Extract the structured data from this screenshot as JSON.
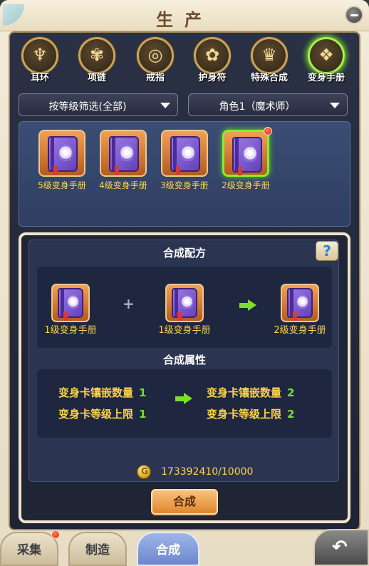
{
  "window": {
    "title": "生产"
  },
  "categories": [
    {
      "label": "耳环",
      "icon": "earring-icon",
      "glyph": "♆"
    },
    {
      "label": "项链",
      "icon": "necklace-icon",
      "glyph": "✾"
    },
    {
      "label": "戒指",
      "icon": "ring-icon",
      "glyph": "◎"
    },
    {
      "label": "护身符",
      "icon": "amulet-icon",
      "glyph": "✿"
    },
    {
      "label": "特殊合成",
      "icon": "special-synthesis-icon",
      "glyph": "♛"
    },
    {
      "label": "变身手册",
      "icon": "transform-manual-icon",
      "glyph": "❖",
      "active": true
    }
  ],
  "filters": {
    "level_filter": "按等级筛选(全部)",
    "character": "角色1（魔术师）"
  },
  "items": [
    {
      "label": "5级变身手册",
      "icon": "purple-book-icon"
    },
    {
      "label": "4级变身手册",
      "icon": "purple-book-icon"
    },
    {
      "label": "3级变身手册",
      "icon": "purple-book-icon"
    },
    {
      "label": "2级变身手册",
      "icon": "purple-book-icon",
      "selected": true,
      "notification": true
    }
  ],
  "recipe": {
    "title": "合成配方",
    "help_label": "?",
    "inputs": [
      "1级变身手册",
      "1级变身手册"
    ],
    "plus": "+",
    "output": "2级变身手册"
  },
  "attributes": {
    "title": "合成属性",
    "before": [
      {
        "name": "变身卡镶嵌数量",
        "value": "1"
      },
      {
        "name": "变身卡等级上限",
        "value": "1"
      }
    ],
    "after": [
      {
        "name": "变身卡镶嵌数量",
        "value": "2"
      },
      {
        "name": "变身卡等级上限",
        "value": "2"
      }
    ]
  },
  "cost": {
    "text": "173392410/10000",
    "icon": "gold-coin-icon"
  },
  "compose_button": "合成",
  "bottom_tabs": [
    {
      "label": "采集",
      "notification": true
    },
    {
      "label": "制造"
    },
    {
      "label": "合成",
      "active": true
    }
  ],
  "colors": {
    "highlight_yellow": "#ffd34a",
    "value_green": "#7ce02a",
    "active_glow": "#78e028"
  }
}
